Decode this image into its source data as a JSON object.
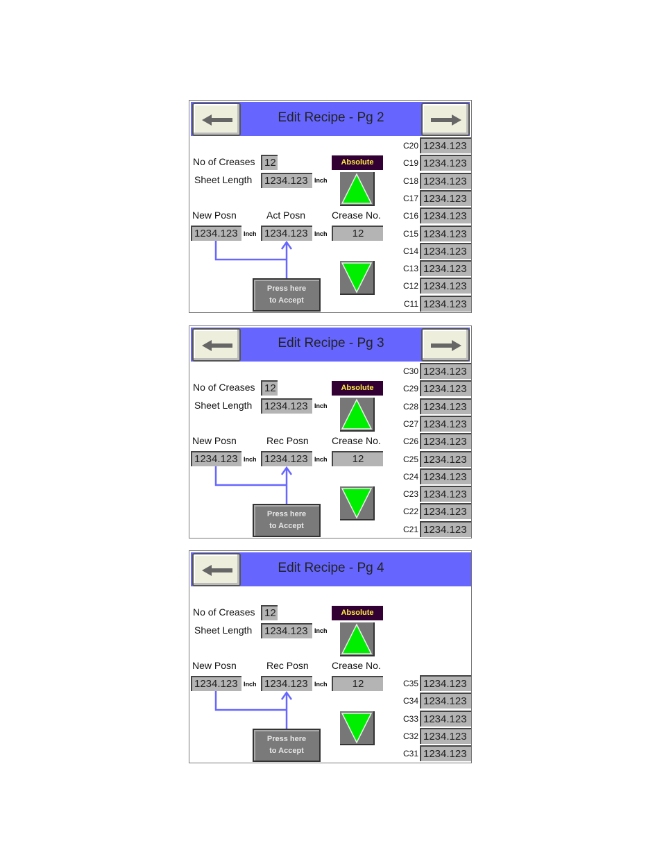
{
  "colors": {
    "header": "#6666ff",
    "absolute_bg": "#330033",
    "absolute_text": "#ffee44",
    "arrow_green": "#00ee00",
    "line_blue": "#6666ff"
  },
  "panels": [
    {
      "title": "Edit Recipe - Pg 2",
      "has_next": true,
      "no_of_creases_label": "No of Creases",
      "no_of_creases": "12",
      "sheet_length_label": "Sheet Length",
      "sheet_length": "1234.123",
      "unit": "Inch",
      "mode": "Absolute",
      "new_posn_label": "New Posn",
      "posn2_label": "Act Posn",
      "crease_no_label": "Crease No.",
      "new_posn": "1234.123",
      "posn2": "1234.123",
      "crease_no": "12",
      "accept_line1": "Press here",
      "accept_line2": "to Accept",
      "full_rows": true,
      "creases": [
        {
          "label": "C20",
          "value": "1234.123"
        },
        {
          "label": "C19",
          "value": "1234.123"
        },
        {
          "label": "C18",
          "value": "1234.123"
        },
        {
          "label": "C17",
          "value": "1234.123"
        },
        {
          "label": "C16",
          "value": "1234.123"
        },
        {
          "label": "C15",
          "value": "1234.123"
        },
        {
          "label": "C14",
          "value": "1234.123"
        },
        {
          "label": "C13",
          "value": "1234.123"
        },
        {
          "label": "C12",
          "value": "1234.123"
        },
        {
          "label": "C11",
          "value": "1234.123"
        }
      ]
    },
    {
      "title": "Edit Recipe - Pg 3",
      "has_next": true,
      "no_of_creases_label": "No of Creases",
      "no_of_creases": "12",
      "sheet_length_label": "Sheet Length",
      "sheet_length": "1234.123",
      "unit": "Inch",
      "mode": "Absolute",
      "new_posn_label": "New Posn",
      "posn2_label": "Rec Posn",
      "crease_no_label": "Crease No.",
      "new_posn": "1234.123",
      "posn2": "1234.123",
      "crease_no": "12",
      "accept_line1": "Press here",
      "accept_line2": "to Accept",
      "full_rows": true,
      "creases": [
        {
          "label": "C30",
          "value": "1234.123"
        },
        {
          "label": "C29",
          "value": "1234.123"
        },
        {
          "label": "C28",
          "value": "1234.123"
        },
        {
          "label": "C27",
          "value": "1234.123"
        },
        {
          "label": "C26",
          "value": "1234.123"
        },
        {
          "label": "C25",
          "value": "1234.123"
        },
        {
          "label": "C24",
          "value": "1234.123"
        },
        {
          "label": "C23",
          "value": "1234.123"
        },
        {
          "label": "C22",
          "value": "1234.123"
        },
        {
          "label": "C21",
          "value": "1234.123"
        }
      ]
    },
    {
      "title": "Edit Recipe - Pg 4",
      "has_next": false,
      "no_of_creases_label": "No of Creases",
      "no_of_creases": "12",
      "sheet_length_label": "Sheet Length",
      "sheet_length": "1234.123",
      "unit": "Inch",
      "mode": "Absolute",
      "new_posn_label": "New Posn",
      "posn2_label": "Rec Posn",
      "crease_no_label": "Crease No.",
      "new_posn": "1234.123",
      "posn2": "1234.123",
      "crease_no": "12",
      "accept_line1": "Press here",
      "accept_line2": "to Accept",
      "full_rows": false,
      "creases": [
        {
          "label": "C35",
          "value": "1234.123"
        },
        {
          "label": "C34",
          "value": "1234.123"
        },
        {
          "label": "C33",
          "value": "1234.123"
        },
        {
          "label": "C32",
          "value": "1234.123"
        },
        {
          "label": "C31",
          "value": "1234.123"
        }
      ]
    }
  ]
}
